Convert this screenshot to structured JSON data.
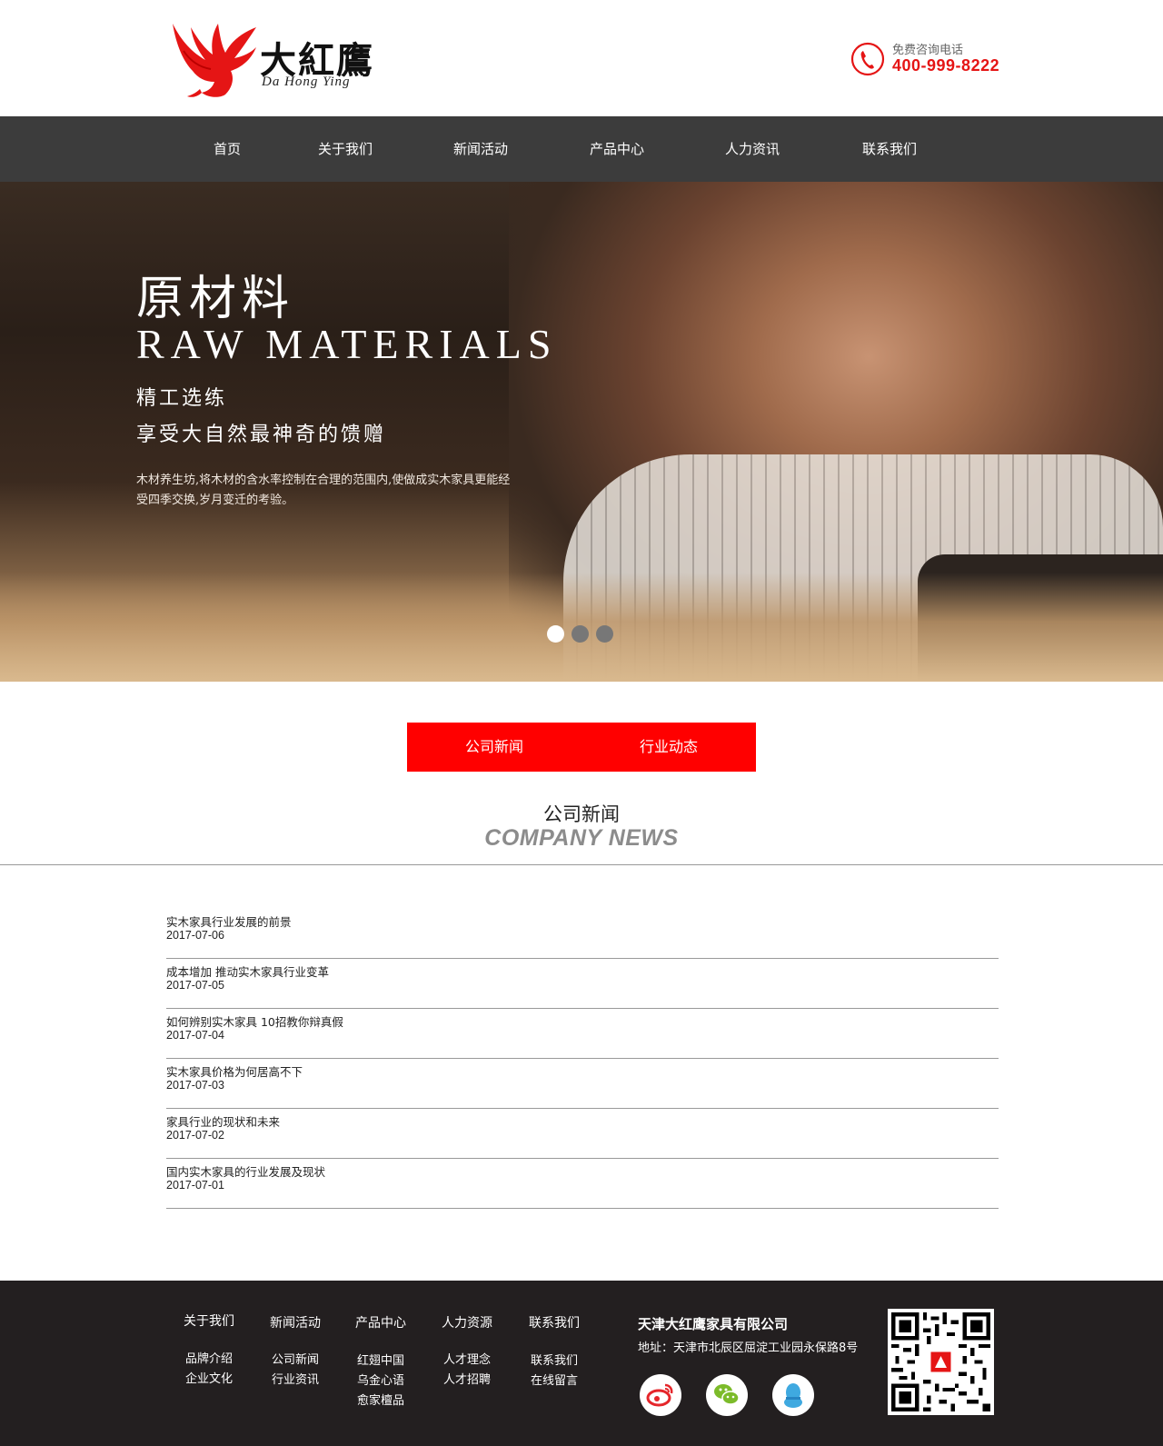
{
  "header": {
    "logo_cn": "大紅鷹",
    "logo_en": "Da Hong Ying",
    "hotline_label": "免费咨询电话",
    "hotline_number": "400-999-8222"
  },
  "nav": {
    "items": [
      "首页",
      "关于我们",
      "新闻活动",
      "产品中心",
      "人力资讯",
      "联系我们"
    ]
  },
  "banner": {
    "title_cn": "原材料",
    "title_en": "RAW MATERIALS",
    "subtitle1": "精工选练",
    "subtitle2": "享受大自然最神奇的馈赠",
    "description": "木材养生坊,将木材的含水率控制在合理的范围内,使做成实木家具更能经受四季交换,岁月变迁的考验。",
    "active_slide": 1,
    "slide_count": 3
  },
  "tabs": [
    "公司新闻",
    "行业动态"
  ],
  "section": {
    "title_cn": "公司新闻",
    "title_en": "COMPANY NEWS"
  },
  "news": [
    {
      "title": "实木家具行业发展的前景",
      "date": "2017-07-06"
    },
    {
      "title": "成本增加 推动实木家具行业变革",
      "date": "2017-07-05"
    },
    {
      "title": "如何辨别实木家具 10招教你辩真假",
      "date": "2017-07-04"
    },
    {
      "title": "实木家具价格为何居高不下",
      "date": "2017-07-03"
    },
    {
      "title": "家具行业的现状和未来",
      "date": "2017-07-02"
    },
    {
      "title": "国内实木家具的行业发展及现状",
      "date": "2017-07-01"
    }
  ],
  "footer": {
    "columns": [
      {
        "head": "关于我们",
        "links": [
          "品牌介绍",
          "企业文化"
        ]
      },
      {
        "head": "新闻活动",
        "links": [
          "公司新闻",
          "行业资讯"
        ]
      },
      {
        "head": "产品中心",
        "links": [
          "红翅中国",
          "乌金心语",
          "愈家檀品"
        ]
      },
      {
        "head": "人力资源",
        "links": [
          "人才理念",
          "人才招聘"
        ]
      },
      {
        "head": "联系我们",
        "links": [
          "联系我们",
          "在线留言"
        ]
      }
    ],
    "company": "天津大红鹰家具有限公司",
    "address": "地址：天津市北辰区屈淀工业园永保路8号",
    "social_icons": [
      "weibo-icon",
      "wechat-icon",
      "qq-icon"
    ]
  },
  "colors": {
    "brand_red": "#ff0000",
    "hotline_red": "#e51515",
    "nav_bg": "#3c3c3c",
    "footer_bg": "#231f20"
  }
}
